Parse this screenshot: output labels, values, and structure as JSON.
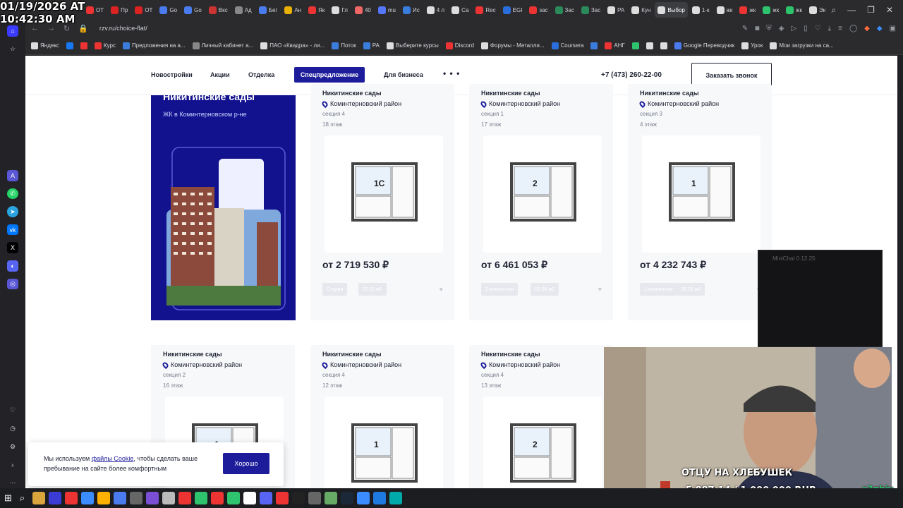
{
  "overlay": {
    "date": "01/19/2026 AT",
    "time": "10:42:30 AM",
    "donation_goal_label": "ОТЦУ НА ХЛЕБУШЕК",
    "donation_amount": "5 887.14 / 1 000 000 RUB",
    "streamer_name": "s3phiv"
  },
  "browser": {
    "tabs": [
      {
        "label": "ОТ",
        "color": "#e33"
      },
      {
        "label": "Пр",
        "color": "#d22"
      },
      {
        "label": "ОТ",
        "color": "#d22"
      },
      {
        "label": "Go",
        "color": "#4a7cf0"
      },
      {
        "label": "Go",
        "color": "#4a7cf0"
      },
      {
        "label": "Вкс",
        "color": "#c33"
      },
      {
        "label": "Ад",
        "color": "#888"
      },
      {
        "label": "Бег",
        "color": "#4a7cf0"
      },
      {
        "label": "Ан",
        "color": "#e8b000"
      },
      {
        "label": "Як",
        "color": "#e33"
      },
      {
        "label": "Гл",
        "color": "#ddd"
      },
      {
        "label": "40",
        "color": "#e66"
      },
      {
        "label": "mu",
        "color": "#5577ff"
      },
      {
        "label": "Ис",
        "color": "#3b7ddd"
      },
      {
        "label": "4 л",
        "color": "#ddd"
      },
      {
        "label": "Са",
        "color": "#ddd"
      },
      {
        "label": "Rec",
        "color": "#e33"
      },
      {
        "label": "EGI",
        "color": "#2a6ddb"
      },
      {
        "label": "зас",
        "color": "#e33"
      },
      {
        "label": "Зас",
        "color": "#2a8a5a"
      },
      {
        "label": "Зас",
        "color": "#2a8a5a"
      },
      {
        "label": "РА",
        "color": "#ddd"
      },
      {
        "label": "Кун",
        "color": "#ddd"
      },
      {
        "label": "Выбор",
        "color": "#ddd",
        "active": true
      },
      {
        "label": "1-к",
        "color": "#ddd"
      },
      {
        "label": "жк",
        "color": "#ddd"
      },
      {
        "label": "жк",
        "color": "#e33"
      },
      {
        "label": "жк",
        "color": "#2ec46d"
      },
      {
        "label": "жк",
        "color": "#2ec46d"
      },
      {
        "label": "Эк",
        "color": "#ddd"
      }
    ],
    "url": "rzv.ru/choice-flat/",
    "bookmarks": [
      {
        "label": "Яндекс",
        "color": "#ddd"
      },
      {
        "label": "",
        "color": "#1877f2"
      },
      {
        "label": "",
        "color": "#e33"
      },
      {
        "label": "Курс",
        "color": "#e33"
      },
      {
        "label": "Предложения на а...",
        "color": "#3b7ddd"
      },
      {
        "label": "Личный кабинет а...",
        "color": "#888"
      },
      {
        "label": "ПАО «Квадра» - ли...",
        "color": "#ddd"
      },
      {
        "label": "Поток",
        "color": "#3b7ddd"
      },
      {
        "label": "РА",
        "color": "#3b7ddd"
      },
      {
        "label": "Выберите курсы",
        "color": "#ddd"
      },
      {
        "label": "Discord",
        "color": "#e33"
      },
      {
        "label": "Форумы - Металли...",
        "color": "#ddd"
      },
      {
        "label": "Coursera",
        "color": "#2a6ddb"
      },
      {
        "label": "",
        "color": "#3b7ddd"
      },
      {
        "label": "АНГ",
        "color": "#e33"
      },
      {
        "label": "",
        "color": "#2ec46d"
      },
      {
        "label": "",
        "color": "#ddd"
      },
      {
        "label": "",
        "color": "#ddd"
      },
      {
        "label": "Google Переводчик",
        "color": "#4a7cf0"
      },
      {
        "label": "Урок",
        "color": "#ddd"
      },
      {
        "label": "Мои загрузки на са...",
        "color": "#ddd"
      }
    ]
  },
  "site": {
    "nav": [
      "Новостройки",
      "Акции",
      "Отделка",
      "Спецпредложение",
      "Для бизнеса"
    ],
    "more": "• • •",
    "phone": "+7 (473) 260-22-00",
    "call_button": "Заказать звонок",
    "promo": {
      "title": "Никитинские сады",
      "subtitle": "ЖК в Коминтерновском р-не"
    },
    "cards": [
      {
        "title": "Никитинские сады",
        "district": "Коминтерновский район",
        "section": "секция 4",
        "floor": "18 этаж",
        "price": "от 2 719 530 ₽",
        "type": "Студия",
        "area": "22.11 м2",
        "rooms": "1С"
      },
      {
        "title": "Никитинские сады",
        "district": "Коминтерновский район",
        "section": "секция 1",
        "floor": "17 этаж",
        "price": "от 6 461 053 ₽",
        "type": "2-комнатная",
        "area": "53.09 м2",
        "rooms": "2"
      },
      {
        "title": "Никитинские сады",
        "district": "Коминтерновский район",
        "section": "секция 3",
        "floor": "4 этаж",
        "price": "от 4 232 743 ₽",
        "type": "1-комнатная",
        "area": "38.15 м2",
        "rooms": "1"
      },
      {
        "title": "Никитинские сады",
        "district": "Коминтерновский район",
        "section": "секция 2",
        "floor": "16 этаж",
        "rooms": "1"
      },
      {
        "title": "Никитинские сады",
        "district": "Коминтерновский район",
        "section": "секция 4",
        "floor": "12 этаж",
        "rooms": "1"
      },
      {
        "title": "Никитинские сады",
        "district": "Коминтерновский район",
        "section": "секция 4",
        "floor": "13 этаж",
        "rooms": "2"
      }
    ],
    "cookie": {
      "text_before": "Мы используем ",
      "link": "файлы Cookie",
      "text_after": ", чтобы сделать ваше пребывание на сайте более комфортным",
      "button": "Хорошо"
    }
  },
  "minichat": {
    "title": "MiniChat 0.12.25"
  }
}
